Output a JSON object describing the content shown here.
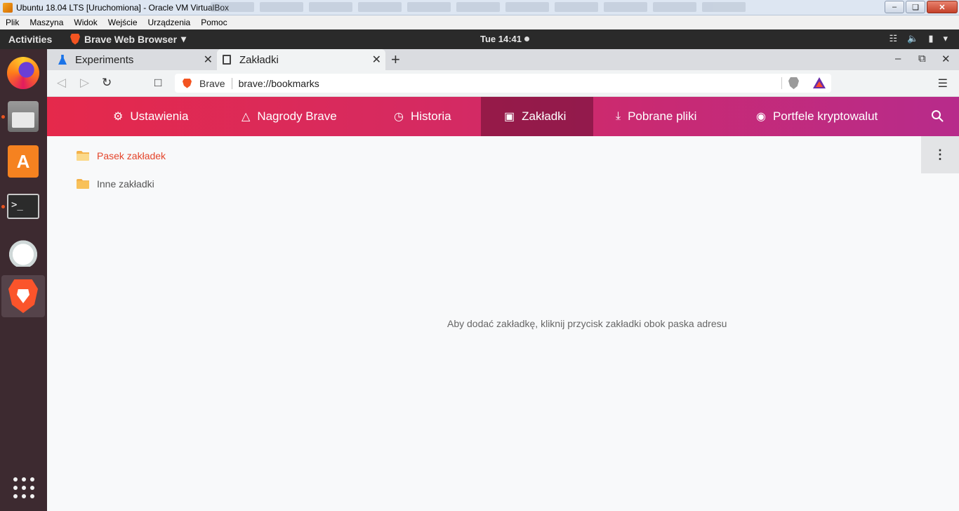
{
  "vbox": {
    "title": "Ubuntu 18.04 LTS [Uruchomiona] - Oracle VM VirtualBox",
    "menu": [
      "Plik",
      "Maszyna",
      "Widok",
      "Wejście",
      "Urządzenia",
      "Pomoc"
    ]
  },
  "panel": {
    "activities": "Activities",
    "app_name": "Brave Web Browser",
    "clock": "Tue 14:41"
  },
  "tabs": [
    {
      "title": "Experiments",
      "icon": "flask-icon",
      "active": false
    },
    {
      "title": "Zakładki",
      "icon": "bookmark-icon",
      "active": true
    }
  ],
  "toolbar": {
    "site_name": "Brave",
    "url": "brave://bookmarks"
  },
  "nav": {
    "items": [
      {
        "label": "Ustawienia",
        "icon": "gear-icon"
      },
      {
        "label": "Nagrody Brave",
        "icon": "rewards-triangle-icon"
      },
      {
        "label": "Historia",
        "icon": "history-icon"
      },
      {
        "label": "Zakładki",
        "icon": "bookmark-icon",
        "selected": true
      },
      {
        "label": "Pobrane pliki",
        "icon": "download-icon"
      },
      {
        "label": "Portfele kryptowalut",
        "icon": "wallet-icon"
      }
    ],
    "accent_start": "#e5294b",
    "accent_end": "#b72b8b"
  },
  "bookmarks": {
    "folders": [
      {
        "label": "Pasek zakładek",
        "open": true
      },
      {
        "label": "Inne zakładki",
        "open": false
      }
    ],
    "empty_message": "Aby dodać zakładkę, kliknij przycisk zakładki obok paska adresu"
  }
}
